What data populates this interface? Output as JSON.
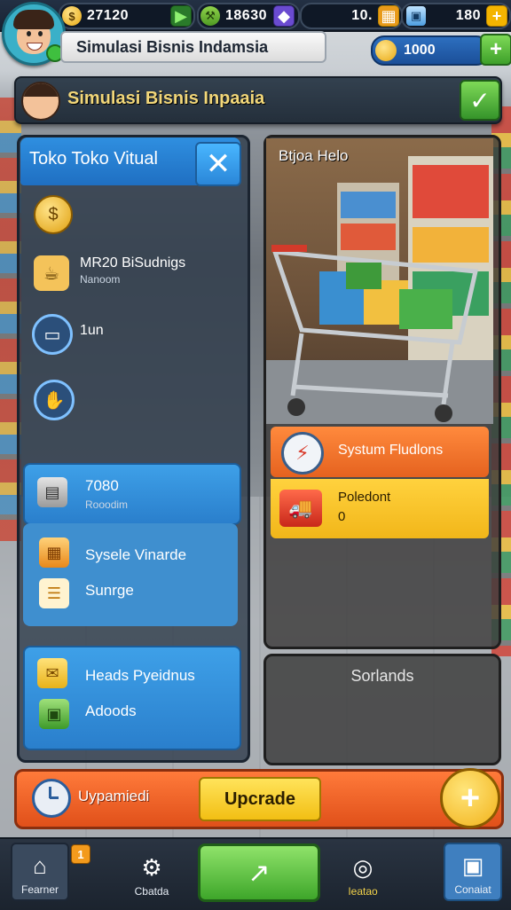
{
  "top_bar": {
    "resources": [
      {
        "name": "coins",
        "icon": "coin-icon",
        "value": "27120"
      },
      {
        "name": "tools",
        "icon": "wrench-icon",
        "value": "18630"
      },
      {
        "name": "gems",
        "icon": "gem-icon",
        "value": "10."
      },
      {
        "name": "boxes",
        "icon": "box-icon",
        "value": "180"
      }
    ]
  },
  "header": {
    "title": "Simulasi Bisnis Indamsia",
    "money": "1000",
    "banner_title": "Simulasi Bisnis Inpaaia"
  },
  "left_panel": {
    "title": "Toko Toko Vitual",
    "rows": [
      {
        "icon": "coin-icon",
        "label": "",
        "sub": ""
      },
      {
        "icon": "cup-icon",
        "label": "MR20 BiSudnigs",
        "sub": "Nanoom"
      },
      {
        "icon": "cart-icon",
        "label": "1un",
        "sub": ""
      },
      {
        "icon": "hand-icon",
        "label": "",
        "sub": ""
      }
    ],
    "card1": {
      "value": "7080",
      "sub": "Rooodim",
      "items": [
        "Sysele Vinarde",
        "Sunrge"
      ]
    },
    "card2": {
      "items": [
        "Heads Pyeidnus",
        "Adoods"
      ]
    }
  },
  "right_panel": {
    "title": "Btjoa Helo",
    "status_row": "Systum Fludlons",
    "product_row": {
      "label": "Poledont",
      "value": "0"
    },
    "bottom_label": "Sorlands"
  },
  "action_bar": {
    "label": "Uypamiedi",
    "button": "Upcrade"
  },
  "nav": {
    "items": [
      {
        "label": "Fearner",
        "icon": "shop-icon"
      },
      {
        "label": "Cbatda",
        "icon": "gear-icon"
      },
      {
        "label": "",
        "icon": "growth-icon"
      },
      {
        "label": "Ieatao",
        "icon": "wheel-icon"
      },
      {
        "label": "Conaiat",
        "icon": "bag-icon"
      }
    ],
    "badge": "1"
  },
  "colors": {
    "accent_blue": "#2a7fcc",
    "accent_orange": "#e5621f",
    "accent_yellow": "#f2b619",
    "accent_green": "#3ea62a"
  }
}
